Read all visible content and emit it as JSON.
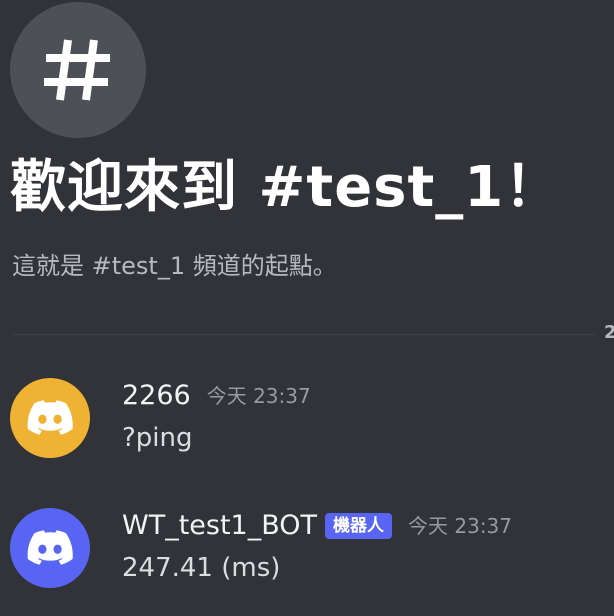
{
  "welcome": {
    "icon": "hashtag-icon",
    "title": "歡迎來到 #test_1！",
    "subtitle": "這就是 #test_1 頻道的起點。"
  },
  "divider": {
    "label": "2"
  },
  "messages": [
    {
      "username": "2266",
      "avatar_color": "#f0b232",
      "avatar_icon": "discord-logo-icon",
      "timestamp": "今天 23:37",
      "content": "?ping",
      "is_bot": false
    },
    {
      "username": "WT_test1_BOT",
      "avatar_color": "#5865f2",
      "avatar_icon": "discord-logo-icon",
      "bot_tag": "機器人",
      "timestamp": "今天 23:37",
      "content": "247.41 (ms)",
      "is_bot": true
    }
  ],
  "colors": {
    "background": "#313338",
    "bot_tag": "#5865f2"
  }
}
